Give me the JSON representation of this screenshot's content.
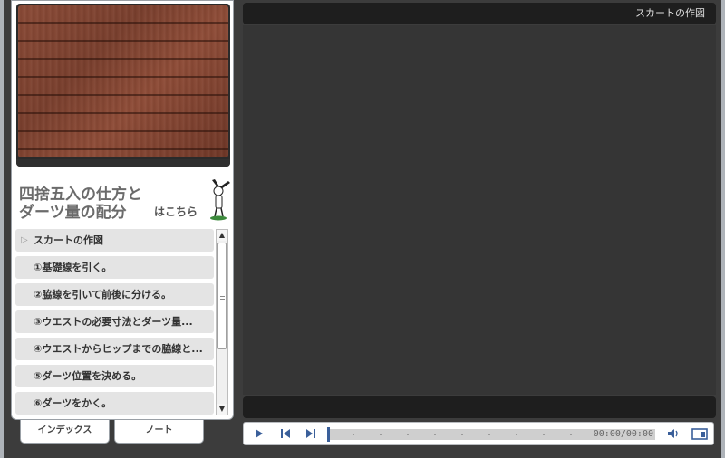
{
  "sidebar": {
    "title_line1": "四捨五入の仕方と",
    "title_line2": "ダーツ量の配分",
    "title_small": "はこちら",
    "toc_items": [
      "スカートの作図",
      "①基礎線を引く。",
      "②脇線を引いて前後に分ける。",
      "③ウエストの必要寸法とダーツ量...",
      "④ウエストからヒップまでの脇線と...",
      "⑤ダーツ位置を決める。",
      "⑥ダーツをかく。"
    ],
    "tabs": [
      "インデックス",
      "ノート"
    ]
  },
  "player": {
    "title": "スカートの作図",
    "time": "00:00/00:00",
    "progress": 0.0,
    "icons": [
      "play-icon",
      "skip-previous-icon",
      "skip-next-icon",
      "volume-icon",
      "layout-icon"
    ]
  },
  "colors": {
    "accent": "#4a6fa5",
    "panel_bg": "#3c3c3c",
    "video_bg": "#353535",
    "bar_bg": "#1e1e1e"
  }
}
